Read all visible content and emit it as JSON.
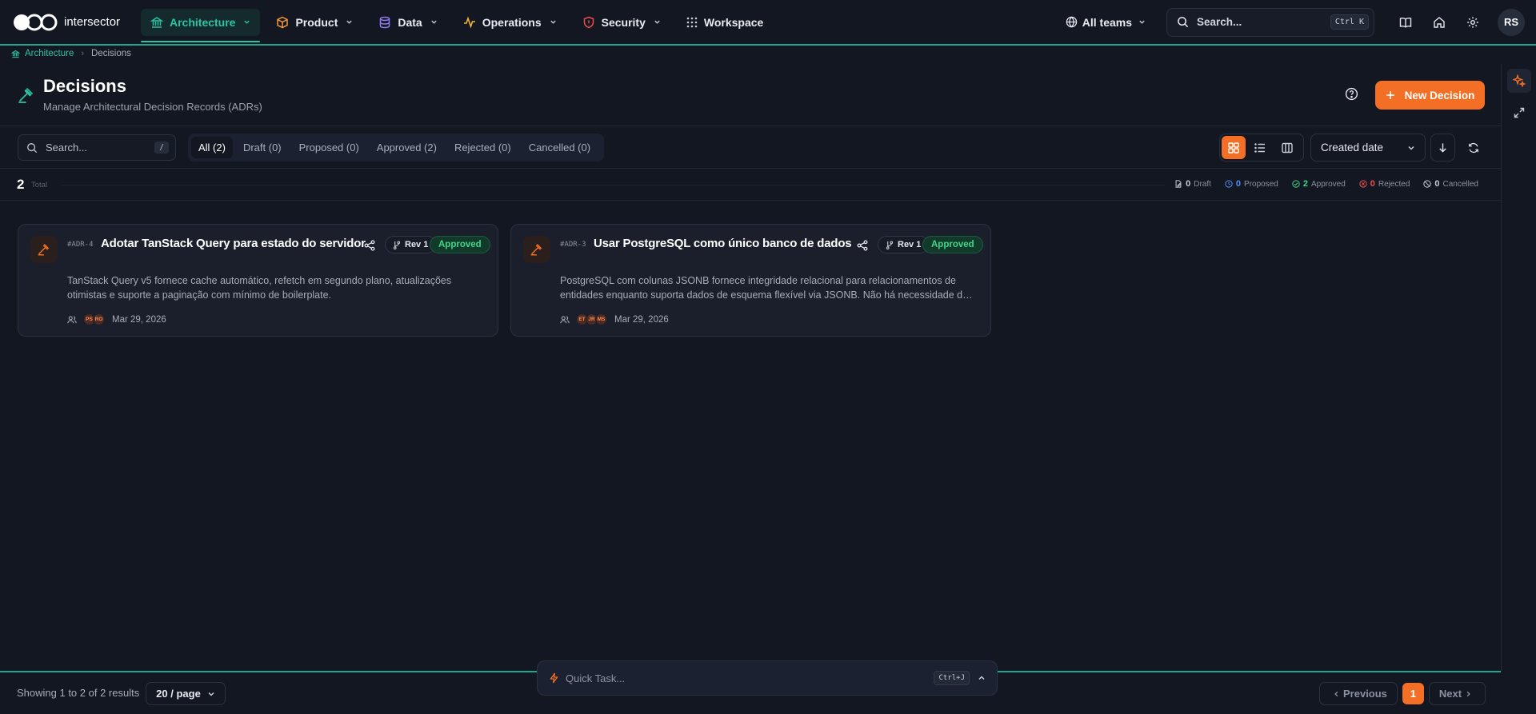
{
  "app": {
    "name": "intersector"
  },
  "nav": {
    "items": [
      {
        "label": "Architecture",
        "icon": "building-columns-icon",
        "color": "#2cc3a5",
        "active": true
      },
      {
        "label": "Product",
        "icon": "cube-icon",
        "color": "#f39a3a"
      },
      {
        "label": "Data",
        "icon": "database-icon",
        "color": "#8f7cf2"
      },
      {
        "label": "Operations",
        "icon": "activity-icon",
        "color": "#f2b33a"
      },
      {
        "label": "Security",
        "icon": "shield-icon",
        "color": "#f04e4e"
      },
      {
        "label": "Workspace",
        "icon": "grid-dots-icon",
        "color": "#c8ccd4"
      }
    ],
    "teams_label": "All teams",
    "search_placeholder": "Search...",
    "search_shortcut": "Ctrl K",
    "user_initials": "RS"
  },
  "breadcrumb": {
    "parent": "Architecture",
    "current": "Decisions"
  },
  "header": {
    "title": "Decisions",
    "subtitle": "Manage Architectural Decision Records (ADRs)",
    "new_button": "New Decision"
  },
  "toolbar": {
    "search_placeholder": "Search...",
    "search_shortcut": "/",
    "tabs": [
      "All (2)",
      "Draft (0)",
      "Proposed (0)",
      "Approved (2)",
      "Rejected (0)",
      "Cancelled (0)"
    ],
    "sort_label": "Created date"
  },
  "stats": {
    "total": "2",
    "total_label": "Total",
    "items": [
      {
        "count": "0",
        "label": "Draft",
        "color": "#c8ccd4"
      },
      {
        "count": "0",
        "label": "Proposed",
        "color": "#4f8ff7"
      },
      {
        "count": "2",
        "label": "Approved",
        "color": "#3fd68a"
      },
      {
        "count": "0",
        "label": "Rejected",
        "color": "#f04e4e"
      },
      {
        "count": "0",
        "label": "Cancelled",
        "color": "#c8ccd4"
      }
    ]
  },
  "cards": [
    {
      "id": "#ADR-4",
      "title": "Adotar TanStack Query para estado do servidor",
      "rev": "Rev 1",
      "status": "Approved",
      "description": "TanStack Query v5 fornece cache automático, refetch em segundo plano, atualizações otimistas e suporte a paginação com mínimo de boilerplate.",
      "avatars": [
        "PS",
        "RO"
      ],
      "date": "Mar 29, 2026"
    },
    {
      "id": "#ADR-3",
      "title": "Usar PostgreSQL como único banco de dados",
      "rev": "Rev 1",
      "status": "Approved",
      "description": "PostgreSQL com colunas JSONB fornece integridade relacional para relacionamentos de entidades enquanto suporta dados de esquema flexível via JSONB. Não há necessidade de um banco de documentos separado.",
      "avatars": [
        "ET",
        "JR",
        "MS"
      ],
      "date": "Mar 29, 2026"
    }
  ],
  "footer": {
    "showing": "Showing 1 to 2 of 2 results",
    "per_page": "20 / page",
    "quick_task_placeholder": "Quick Task...",
    "quick_task_shortcut": "Ctrl+J",
    "previous": "Previous",
    "page": "1",
    "next": "Next"
  }
}
